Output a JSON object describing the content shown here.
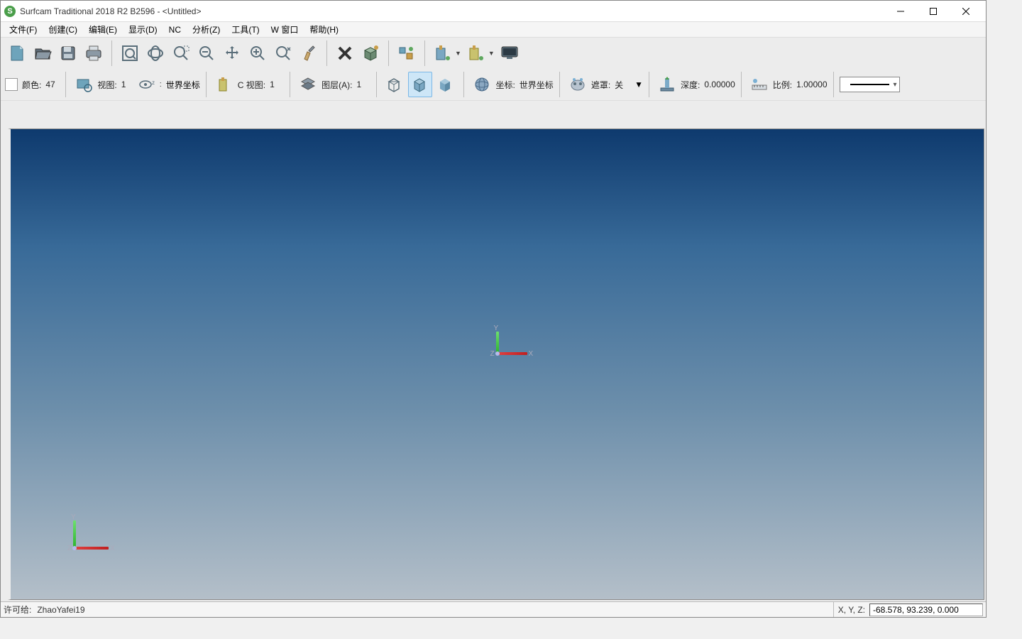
{
  "title": "Surfcam Traditional 2018 R2  B2596 - <Untitled>",
  "menu": {
    "file": "文件(F)",
    "create": "创建(C)",
    "edit": "编辑(E)",
    "display": "显示(D)",
    "nc": "NC",
    "analyze": "分析(Z)",
    "tools": "工具(T)",
    "window": "W 窗口",
    "help": "帮助(H)"
  },
  "row2": {
    "color_label": "颜色:",
    "color_value": "47",
    "view_label": "视图:",
    "view_value": "1",
    "world_cs": "世界坐标",
    "cview_label": "C 视图:",
    "cview_value": "1",
    "layer_label": "图层(A):",
    "layer_value": "1",
    "coord_label": "坐标:",
    "coord_value": "世界坐标",
    "mask_label": "遮罩:",
    "mask_value": "关",
    "depth_label": "深度:",
    "depth_value": "0.00000",
    "scale_label": "比例:",
    "scale_value": "1.00000"
  },
  "triad": {
    "x": "X",
    "y": "Y",
    "z": "Z"
  },
  "status": {
    "license_label": "许可给:",
    "license_value": "ZhaoYafei19",
    "xyz_label": "X, Y, Z:",
    "xyz_value": "-68.578, 93.239, 0.000"
  }
}
